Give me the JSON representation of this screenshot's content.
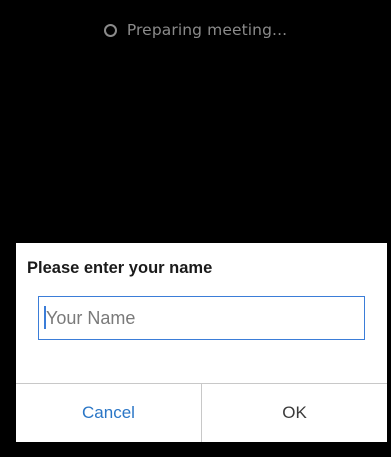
{
  "status": {
    "text": "Preparing meeting...",
    "icon": "spinner-icon"
  },
  "dialog": {
    "title": "Please enter your name",
    "input": {
      "value": "",
      "placeholder": "Your Name"
    },
    "cancel_label": "Cancel",
    "ok_label": "OK"
  },
  "colors": {
    "background": "#000000",
    "accent": "#2a76c6",
    "input_border": "#3b7dd8"
  }
}
